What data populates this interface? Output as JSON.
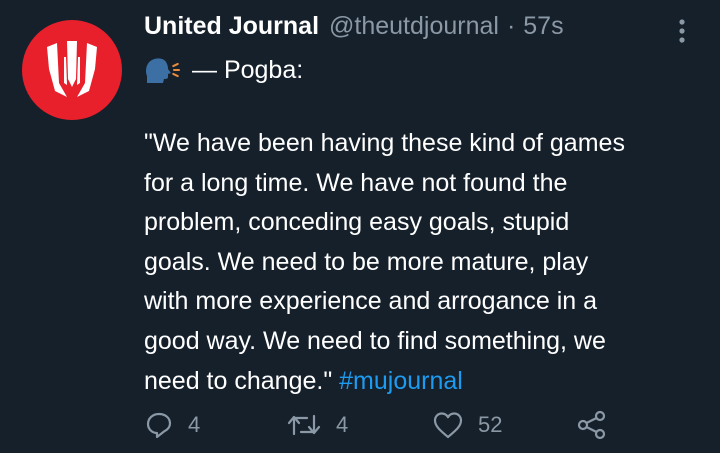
{
  "tweet": {
    "display_name": "United Journal",
    "handle": "@theutdjournal",
    "separator": "·",
    "time": "57s",
    "intro_text": "— Pogba:",
    "body_lines": [
      "\"We have been having these kind of games",
      "for a long time. We have not found the",
      "problem, conceding easy goals, stupid",
      "goals. We need to be more mature, play",
      "with more experience and arrogance in a",
      "good way. We need to find something, we"
    ],
    "last_line_text": "need to change.\" ",
    "hashtag": "#mujournal"
  },
  "actions": {
    "reply_count": "4",
    "retweet_count": "4",
    "like_count": "52"
  },
  "icons": {
    "avatar": "united-journal-logo",
    "speaker": "speaking-head-emoji",
    "more": "more-options-icon",
    "reply": "reply-icon",
    "retweet": "retweet-icon",
    "like": "heart-icon",
    "share": "share-icon"
  },
  "colors": {
    "background": "#15202b",
    "text": "#ffffff",
    "secondary_text": "#8b98a5",
    "link": "#1d9bf0",
    "avatar": "#e8202c"
  }
}
